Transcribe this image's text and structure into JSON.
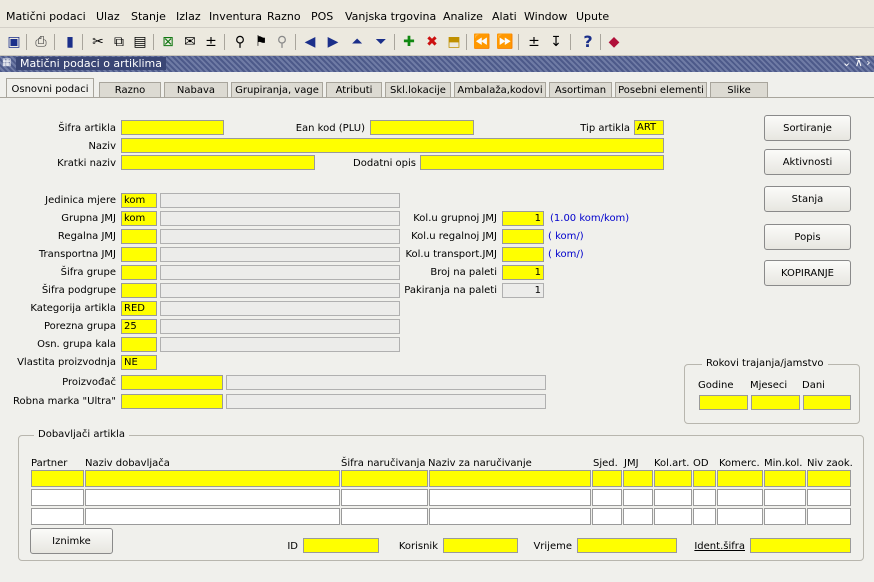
{
  "menu": [
    "Matični podaci",
    "Ulaz",
    "Stanje",
    "Izlaz",
    "Inventura",
    "Razno",
    "POS",
    "Vanjska trgovina",
    "Analize",
    "Alati",
    "Window",
    "Upute"
  ],
  "toolbar_icons": [
    "save-icon",
    "print-icon",
    "exit-icon",
    "cut-icon",
    "copy-icon",
    "paste-icon",
    "excel-icon",
    "mail-icon",
    "download-icon",
    "query-icon",
    "execute-query-icon",
    "cancel-query-icon",
    "prev-record-icon",
    "next-record-icon",
    "first-block-icon",
    "last-block-icon",
    "insert-record-icon",
    "delete-record-icon",
    "lock-icon",
    "first-record-icon",
    "last-record-icon",
    "sort-asc-icon",
    "sort-desc-icon",
    "help-icon",
    "diamond-icon"
  ],
  "window_title": "Matični podaci o artiklima",
  "tabs": [
    "Osnovni podaci",
    "Razno",
    "Nabava",
    "Grupiranja, vage",
    "Atributi",
    "Skl.lokacije",
    "Ambalaža,kodovi",
    "Asortiman",
    "Posebni elementi",
    "Slike"
  ],
  "labels": {
    "sifra": "Šifra artikla",
    "ean": "Ean kod (PLU)",
    "tip": "Tip artikla",
    "naziv": "Naziv",
    "kratki": "Kratki naziv",
    "dodatni": "Dodatni opis",
    "jedinica": "Jedinica mjere",
    "grupna": "Grupna JMJ",
    "regalna": "Regalna JMJ",
    "transportna": "Transportna JMJ",
    "sgrupe": "Šifra grupe",
    "spodgrupe": "Šifra podgrupe",
    "kategorija": "Kategorija artikla",
    "porezna": "Porezna grupa",
    "osn": "Osn. grupa kala",
    "vlastita": "Vlastita proizvodnja",
    "proizvodac": "Proizvođač",
    "robna": "Robna marka \"Ultra\"",
    "kol_grupnoj": "Kol.u grupnoj JMJ",
    "kol_regalnoj": "Kol.u regalnoj JMJ",
    "kol_transport": "Kol.u transport.JMJ",
    "broj_paleti": "Broj na paleti",
    "pakiranja": "Pakiranja na paleti"
  },
  "values": {
    "tip": "ART",
    "jedinica": "kom",
    "grupna": "kom",
    "kategorija": "RED",
    "porezna": "25",
    "vlastita": "NE",
    "kol_grupnoj": "1",
    "broj_paleti": "1",
    "pakiranja": "1"
  },
  "notes": {
    "grupna": "(1.00 kom/kom)",
    "regalna": "( kom/)",
    "transport": "( kom/)"
  },
  "buttons": [
    "Sortiranje",
    "Aktivnosti",
    "Stanja",
    "Popis",
    "KOPIRANJE"
  ],
  "rokovi": {
    "title": "Rokovi trajanja/jamstvo",
    "cols": [
      "Godine",
      "Mjeseci",
      "Dani"
    ]
  },
  "dobavljaci": {
    "title": "Dobavljači artikla",
    "columns": [
      "Partner",
      "Naziv dobavljača",
      "Šifra naručivanja",
      "Naziv za naručivanje",
      "Sjed.",
      "JMJ",
      "Kol.art.",
      "OD",
      "Komerc.",
      "Min.kol.",
      "Niv zaok."
    ]
  },
  "footer": {
    "iznimke": "Iznimke",
    "id": "ID",
    "korisnik": "Korisnik",
    "vrijeme": "Vrijeme",
    "ident": "Ident.šifra"
  },
  "window_controls": "⌄ ⊼ ›",
  "colors": {
    "field": "#ffff00",
    "note": "#0000cc",
    "title": "#3a4675"
  }
}
